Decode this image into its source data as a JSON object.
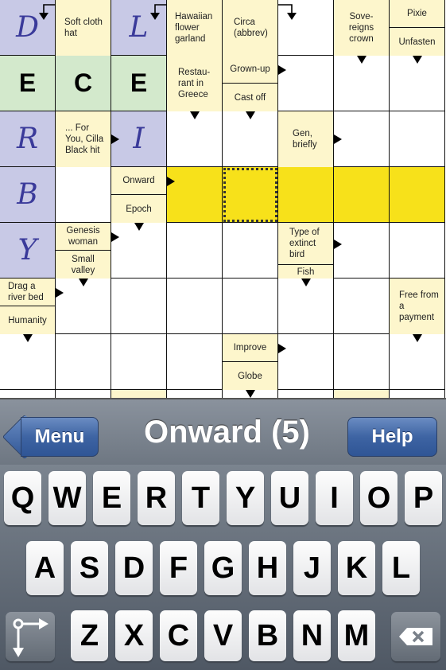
{
  "grid": {
    "columns": 8,
    "rows_visible": 7,
    "colors": {
      "solved_letter_cell": "#c8c9e6",
      "entered_letter_cell": "#d3e9cc",
      "active_word": "#f7e11a",
      "clue_cell": "#fdf6cc",
      "script_letter": "#3a3a9a"
    },
    "letters": {
      "r0c0": "D",
      "r0c2": "L",
      "r1c0": "E",
      "r1c1": "C",
      "r1c2": "E",
      "r2c0": "R",
      "r2c2": "I",
      "r3c0": "B",
      "r4c0": "Y"
    },
    "clues": {
      "soft_cloth_hat": "Soft cloth hat",
      "hawaiian": "Hawaiian flower garland",
      "circa": "Circa (abbrev)",
      "sovereigns": "Sove-reigns crown",
      "pixie": "Pixie",
      "unfasten": "Unfasten",
      "restaurant": "Restau-rant in Greece",
      "grown_up": "Grown-up",
      "cast_off": "Cast off",
      "for_you": "... For You, Cilla Black hit",
      "gen": "Gen, briefly",
      "onward": "Onward",
      "epoch": "Epoch",
      "genesis": "Genesis woman",
      "small_valley": "Small valley",
      "extinct_bird": "Type of extinct bird",
      "fish": "Fish",
      "drag": "Drag a river bed",
      "humanity": "Humanity",
      "free": "Free from a payment",
      "improve": "Improve",
      "globe": "Globe"
    }
  },
  "bar": {
    "menu_label": "Menu",
    "title": "Onward (5)",
    "help_label": "Help"
  },
  "keyboard": {
    "row1": [
      "Q",
      "W",
      "E",
      "R",
      "T",
      "Y",
      "U",
      "I",
      "O",
      "P"
    ],
    "row2": [
      "A",
      "S",
      "D",
      "F",
      "G",
      "H",
      "J",
      "K",
      "L"
    ],
    "row3": [
      "Z",
      "X",
      "C",
      "V",
      "B",
      "N",
      "M"
    ],
    "direction_toggle_icon": "direction-toggle-icon",
    "backspace_icon": "backspace-icon"
  }
}
